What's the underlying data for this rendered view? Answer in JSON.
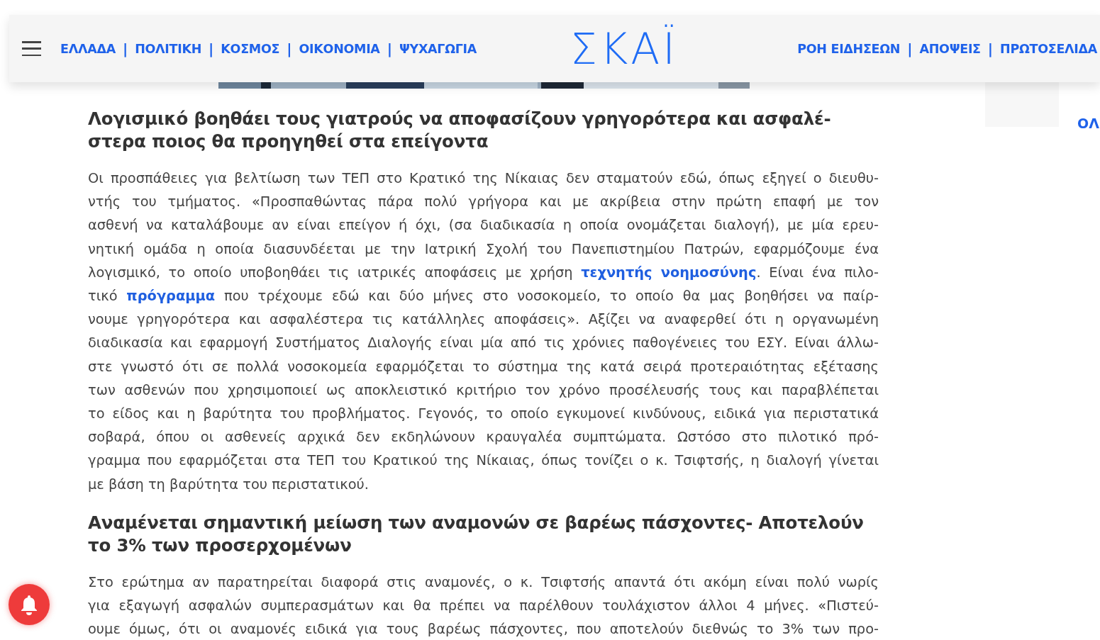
{
  "header": {
    "nav_left": [
      {
        "label": "ΕΛΛΑΔΑ"
      },
      {
        "label": "ΠΟΛΙΤΙΚΗ"
      },
      {
        "label": "ΚΟΣΜΟΣ"
      },
      {
        "label": "ΟΙΚΟΝΟΜΙΑ"
      },
      {
        "label": "ΨΥΧΑΓΩΓΙΑ"
      }
    ],
    "separator": "|",
    "logo": "ΣΚΑΪ",
    "nav_right": [
      {
        "label": "ΡΟΗ ΕΙΔΗΣΕΩΝ"
      },
      {
        "label": "ΑΠΟΨΕΙΣ"
      },
      {
        "label": "ΠΡΩΤΟΣΕΛΙΔΑ"
      }
    ]
  },
  "sidebar": {
    "link": "ΟΛ"
  },
  "article": [
    {
      "kind": "heading",
      "lines": [
        "Λογισμικό βοηθάει τους γιατρούς να αποφασίζουν γρηγορότερα και ασφαλέ-",
        "στερα ποιος θα προηγηθεί στα επείγοντα"
      ]
    },
    {
      "kind": "paragraph",
      "lines": [
        [
          {
            "kind": "text",
            "text": "Οι προσπάθειες για βελτίωση των ΤΕΠ στο Κρατικό της Νίκαιας δεν σταματούν εδώ, όπως εξηγεί ο διευθυ-"
          }
        ],
        [
          {
            "kind": "text",
            "text": "ντής του τμήματος. «Προσπαθώντας πάρα πολύ γρήγορα και με ακρίβεια στην πρώτη επαφή με τον"
          }
        ],
        [
          {
            "kind": "text",
            "text": "ασθενή να καταλάβουμε αν είναι επείγον ή όχι, (σα διαδικασία η οποία ονομάζεται διαλογή), με μία ερευ-"
          }
        ],
        [
          {
            "kind": "text",
            "text": "νητική ομάδα η οποία διασυνδέεται με την Ιατρική Σχολή του Πανεπιστημίου Πατρών, εφαρμόζουμε ένα"
          }
        ],
        [
          {
            "kind": "text",
            "text": "λογισμικό, το οποίο υποβοηθάει τις ιατρικές αποφάσεις με χρήση "
          },
          {
            "kind": "link",
            "text": "τεχνητής νοημοσύνης"
          },
          {
            "kind": "text",
            "text": ". Είναι ένα πιλο-"
          }
        ],
        [
          {
            "kind": "text",
            "text": "τικό "
          },
          {
            "kind": "link",
            "text": "πρόγραμμα"
          },
          {
            "kind": "text",
            "text": " που τρέχουμε εδώ και δύο μήνες στο νοσοκομείο, το οποίο θα μας βοηθήσει να παίρ-"
          }
        ],
        [
          {
            "kind": "text",
            "text": "νουμε γρηγορότερα και ασφαλέστερα τις κατάλληλες αποφάσεις». Αξίζει να αναφερθεί ότι η οργανωμένη"
          }
        ],
        [
          {
            "kind": "text",
            "text": "διαδικασία και εφαρμογή Συστήματος Διαλογής είναι μία από τις χρόνιες παθογένειες του ΕΣΥ. Είναι άλλω-"
          }
        ],
        [
          {
            "kind": "text",
            "text": "στε γνωστό ότι σε πολλά νοσοκομεία εφαρμόζεται το σύστημα της κατά σειρά προτεραιότητας εξέτασης"
          }
        ],
        [
          {
            "kind": "text",
            "text": "των ασθενών που χρησιμοποιεί ως αποκλειστικό κριτήριο τον χρόνο προσέλευσής τους και παραβλέπεται"
          }
        ],
        [
          {
            "kind": "text",
            "text": "το είδος και η βαρύτητα του προβλήματος. Γεγονός, το οποίο εγκυμονεί κινδύνους, ειδικά για περιστατικά"
          }
        ],
        [
          {
            "kind": "text",
            "text": "σοβαρά, όπου οι ασθενείς αρχικά δεν εκδηλώνουν κραυγαλέα συμπτώματα. Ωστόσο στο πιλοτικό πρό-"
          }
        ],
        [
          {
            "kind": "text",
            "text": "γραμμα που εφαρμόζεται στα ΤΕΠ του Κρατικού της Νίκαιας, όπως τονίζει ο κ. Τσιφτσής, η διαλογή γίνεται"
          }
        ],
        [
          {
            "kind": "text",
            "text": "με βάση τη βαρύτητα του περιστατικού."
          }
        ]
      ]
    },
    {
      "kind": "heading",
      "lines": [
        "Αναμένεται σημαντική μείωση των αναμονών σε βαρέως πάσχοντες- Αποτελούν",
        "το 3% των προσερχομένων"
      ]
    },
    {
      "kind": "paragraph",
      "lines": [
        [
          {
            "kind": "text",
            "text": "Στο ερώτημα αν παρατηρείται διαφορά στις αναμονές, ο κ. Τσιφτσής απαντά ότι ακόμη είναι πολύ νωρίς"
          }
        ],
        [
          {
            "kind": "text",
            "text": "για εξαγωγή ασφαλών συμπερασμάτων και θα πρέπει να παρέλθουν τουλάχιστον άλλοι 4 μήνες. «Πιστεύ-"
          }
        ],
        [
          {
            "kind": "text",
            "text": "ουμε όμως, ότι οι αναμονές ειδικά για τους βαρέως πάσχοντες, που αποτελούν διεθνώς το 3% των προ-"
          }
        ]
      ]
    }
  ]
}
